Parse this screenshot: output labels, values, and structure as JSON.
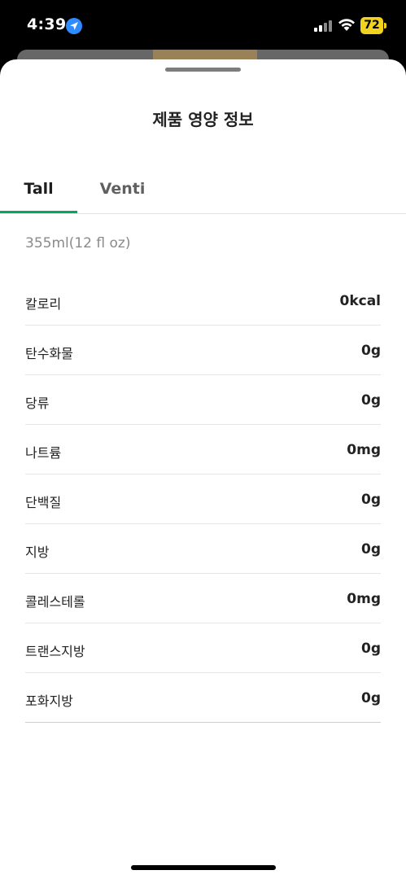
{
  "status_bar": {
    "time": "4:39",
    "battery_level": "72",
    "icons": [
      "location-arrow-icon",
      "signal-icon",
      "wifi-icon",
      "battery-icon"
    ],
    "battery_color": "#f2d21c",
    "location_color": "#2f8cff"
  },
  "sheet": {
    "title": "제품 영양 정보",
    "tabs": [
      {
        "label": "Tall",
        "selected": true
      },
      {
        "label": "Venti",
        "selected": false
      }
    ],
    "accent_color": "#00a862",
    "serving_size": "355ml(12 fl oz)",
    "nutrition": [
      {
        "name": "칼로리",
        "value": "0kcal"
      },
      {
        "name": "탄수화물",
        "value": "0g"
      },
      {
        "name": "당류",
        "value": "0g"
      },
      {
        "name": "나트륨",
        "value": "0mg"
      },
      {
        "name": "단백질",
        "value": "0g"
      },
      {
        "name": "지방",
        "value": "0g"
      },
      {
        "name": "콜레스테롤",
        "value": "0mg"
      },
      {
        "name": "트랜스지방",
        "value": "0g"
      },
      {
        "name": "포화지방",
        "value": "0g"
      }
    ]
  }
}
